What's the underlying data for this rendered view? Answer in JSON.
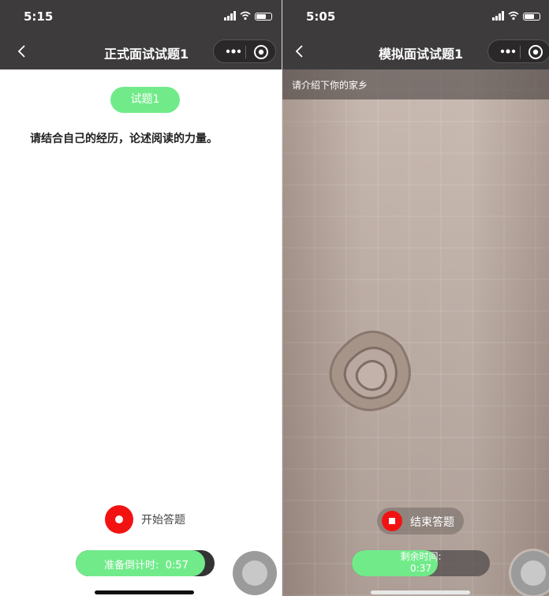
{
  "left": {
    "status": {
      "time": "5:15"
    },
    "nav": {
      "title": "正式面试试题1"
    },
    "question_badge": "试题1",
    "question_text": "请结合自己的经历，论述阅读的力量。",
    "record_label": "开始答题",
    "countdown": {
      "label": "准备倒计时:",
      "value": "0:57",
      "progress": 0.93
    }
  },
  "right": {
    "status": {
      "time": "5:05"
    },
    "nav": {
      "title": "模拟面试试题1"
    },
    "prompt": "请介绍下你的家乡",
    "stop_label": "结束答题",
    "remaining": {
      "label": "剩余时间:",
      "value": "0:37",
      "progress": 0.62
    }
  },
  "icons": {
    "back": "chevron-left-icon",
    "more": "more-dots-icon",
    "close": "target-circle-icon",
    "record": "record-icon",
    "stop": "stop-icon"
  },
  "colors": {
    "accent_green": "#71eb8a",
    "record_red": "#f21212",
    "bar_dark": "#3d3b3c"
  }
}
